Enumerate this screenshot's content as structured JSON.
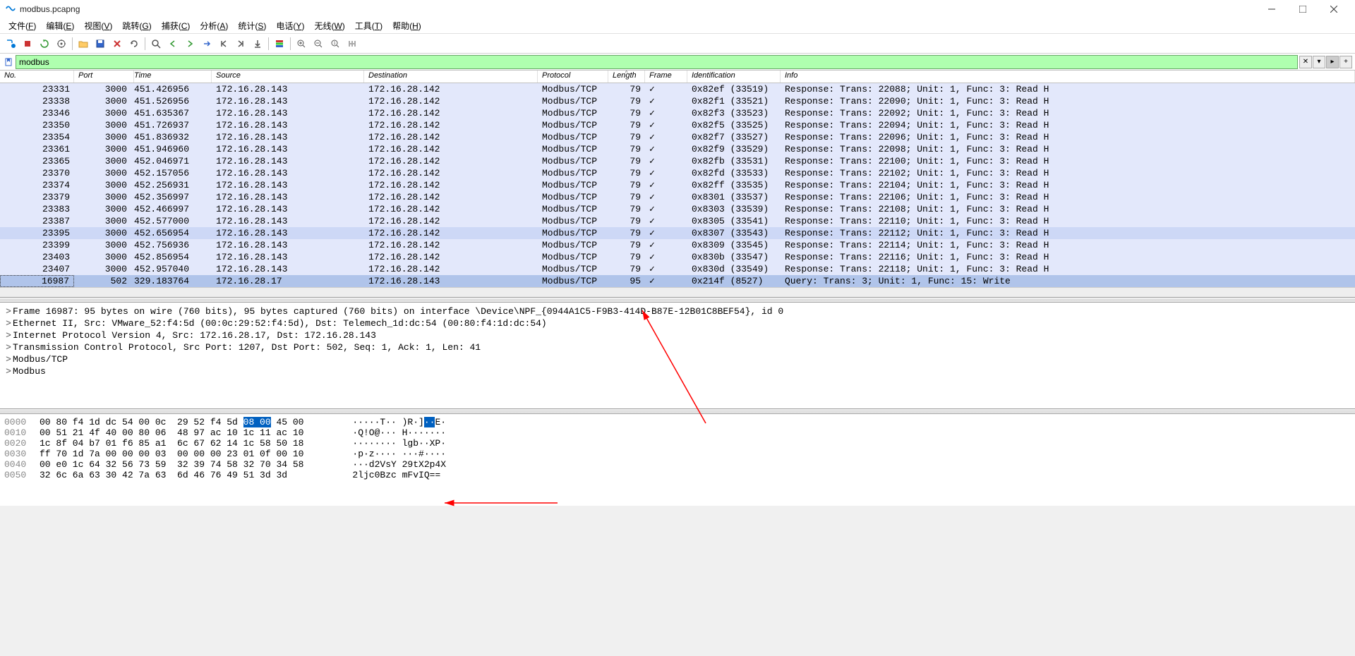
{
  "titlebar": {
    "title": "modbus.pcapng"
  },
  "menu": {
    "items": [
      {
        "l": "文件",
        "u": "F"
      },
      {
        "l": "编辑",
        "u": "E"
      },
      {
        "l": "视图",
        "u": "V"
      },
      {
        "l": "跳转",
        "u": "G"
      },
      {
        "l": "捕获",
        "u": "C"
      },
      {
        "l": "分析",
        "u": "A"
      },
      {
        "l": "统计",
        "u": "S"
      },
      {
        "l": "电话",
        "u": "Y"
      },
      {
        "l": "无线",
        "u": "W"
      },
      {
        "l": "工具",
        "u": "T"
      },
      {
        "l": "帮助",
        "u": "H"
      }
    ]
  },
  "filter": {
    "value": "modbus"
  },
  "columns": [
    "No.",
    "Port",
    "Time",
    "Source",
    "Destination",
    "Protocol",
    "Length",
    "Frame",
    "Identification",
    "Info"
  ],
  "rows": [
    {
      "no": "23331",
      "port": "3000",
      "time": "451.426956",
      "src": "172.16.28.143",
      "dst": "172.16.28.142",
      "proto": "Modbus/TCP",
      "len": "79",
      "frame": "✓",
      "ident": "0x82ef (33519)",
      "info": "Response: Trans: 22088; Unit:   1, Func:   3: Read H",
      "cls": "normal"
    },
    {
      "no": "23338",
      "port": "3000",
      "time": "451.526956",
      "src": "172.16.28.143",
      "dst": "172.16.28.142",
      "proto": "Modbus/TCP",
      "len": "79",
      "frame": "✓",
      "ident": "0x82f1 (33521)",
      "info": "Response: Trans: 22090; Unit:   1, Func:   3: Read H",
      "cls": "normal"
    },
    {
      "no": "23346",
      "port": "3000",
      "time": "451.635367",
      "src": "172.16.28.143",
      "dst": "172.16.28.142",
      "proto": "Modbus/TCP",
      "len": "79",
      "frame": "✓",
      "ident": "0x82f3 (33523)",
      "info": "Response: Trans: 22092; Unit:   1, Func:   3: Read H",
      "cls": "normal"
    },
    {
      "no": "23350",
      "port": "3000",
      "time": "451.726937",
      "src": "172.16.28.143",
      "dst": "172.16.28.142",
      "proto": "Modbus/TCP",
      "len": "79",
      "frame": "✓",
      "ident": "0x82f5 (33525)",
      "info": "Response: Trans: 22094; Unit:   1, Func:   3: Read H",
      "cls": "normal"
    },
    {
      "no": "23354",
      "port": "3000",
      "time": "451.836932",
      "src": "172.16.28.143",
      "dst": "172.16.28.142",
      "proto": "Modbus/TCP",
      "len": "79",
      "frame": "✓",
      "ident": "0x82f7 (33527)",
      "info": "Response: Trans: 22096; Unit:   1, Func:   3: Read H",
      "cls": "normal"
    },
    {
      "no": "23361",
      "port": "3000",
      "time": "451.946960",
      "src": "172.16.28.143",
      "dst": "172.16.28.142",
      "proto": "Modbus/TCP",
      "len": "79",
      "frame": "✓",
      "ident": "0x82f9 (33529)",
      "info": "Response: Trans: 22098; Unit:   1, Func:   3: Read H",
      "cls": "normal"
    },
    {
      "no": "23365",
      "port": "3000",
      "time": "452.046971",
      "src": "172.16.28.143",
      "dst": "172.16.28.142",
      "proto": "Modbus/TCP",
      "len": "79",
      "frame": "✓",
      "ident": "0x82fb (33531)",
      "info": "Response: Trans: 22100; Unit:   1, Func:   3: Read H",
      "cls": "normal"
    },
    {
      "no": "23370",
      "port": "3000",
      "time": "452.157056",
      "src": "172.16.28.143",
      "dst": "172.16.28.142",
      "proto": "Modbus/TCP",
      "len": "79",
      "frame": "✓",
      "ident": "0x82fd (33533)",
      "info": "Response: Trans: 22102; Unit:   1, Func:   3: Read H",
      "cls": "normal"
    },
    {
      "no": "23374",
      "port": "3000",
      "time": "452.256931",
      "src": "172.16.28.143",
      "dst": "172.16.28.142",
      "proto": "Modbus/TCP",
      "len": "79",
      "frame": "✓",
      "ident": "0x82ff (33535)",
      "info": "Response: Trans: 22104; Unit:   1, Func:   3: Read H",
      "cls": "normal"
    },
    {
      "no": "23379",
      "port": "3000",
      "time": "452.356997",
      "src": "172.16.28.143",
      "dst": "172.16.28.142",
      "proto": "Modbus/TCP",
      "len": "79",
      "frame": "✓",
      "ident": "0x8301 (33537)",
      "info": "Response: Trans: 22106; Unit:   1, Func:   3: Read H",
      "cls": "normal"
    },
    {
      "no": "23383",
      "port": "3000",
      "time": "452.466997",
      "src": "172.16.28.143",
      "dst": "172.16.28.142",
      "proto": "Modbus/TCP",
      "len": "79",
      "frame": "✓",
      "ident": "0x8303 (33539)",
      "info": "Response: Trans: 22108; Unit:   1, Func:   3: Read H",
      "cls": "normal"
    },
    {
      "no": "23387",
      "port": "3000",
      "time": "452.577000",
      "src": "172.16.28.143",
      "dst": "172.16.28.142",
      "proto": "Modbus/TCP",
      "len": "79",
      "frame": "✓",
      "ident": "0x8305 (33541)",
      "info": "Response: Trans: 22110; Unit:   1, Func:   3: Read H",
      "cls": "normal"
    },
    {
      "no": "23395",
      "port": "3000",
      "time": "452.656954",
      "src": "172.16.28.143",
      "dst": "172.16.28.142",
      "proto": "Modbus/TCP",
      "len": "79",
      "frame": "✓",
      "ident": "0x8307 (33543)",
      "info": "Response: Trans: 22112; Unit:   1, Func:   3: Read H",
      "cls": "sel1"
    },
    {
      "no": "23399",
      "port": "3000",
      "time": "452.756936",
      "src": "172.16.28.143",
      "dst": "172.16.28.142",
      "proto": "Modbus/TCP",
      "len": "79",
      "frame": "✓",
      "ident": "0x8309 (33545)",
      "info": "Response: Trans: 22114; Unit:   1, Func:   3: Read H",
      "cls": "normal"
    },
    {
      "no": "23403",
      "port": "3000",
      "time": "452.856954",
      "src": "172.16.28.143",
      "dst": "172.16.28.142",
      "proto": "Modbus/TCP",
      "len": "79",
      "frame": "✓",
      "ident": "0x830b (33547)",
      "info": "Response: Trans: 22116; Unit:   1, Func:   3: Read H",
      "cls": "normal"
    },
    {
      "no": "23407",
      "port": "3000",
      "time": "452.957040",
      "src": "172.16.28.143",
      "dst": "172.16.28.142",
      "proto": "Modbus/TCP",
      "len": "79",
      "frame": "✓",
      "ident": "0x830d (33549)",
      "info": "Response: Trans: 22118; Unit:   1, Func:   3: Read H",
      "cls": "normal"
    },
    {
      "no": "16987",
      "port": "502",
      "time": "329.183764",
      "src": "172.16.28.17",
      "dst": "172.16.28.143",
      "proto": "Modbus/TCP",
      "len": "95",
      "frame": "✓",
      "ident": "0x214f (8527)",
      "info": "   Query: Trans:     3; Unit:   1, Func:  15: Write ",
      "cls": "sel2"
    }
  ],
  "details": [
    {
      "tw": ">",
      "text": "Frame 16987: 95 bytes on wire (760 bits), 95 bytes captured (760 bits) on interface \\Device\\NPF_{0944A1C5-F9B3-414D-B87E-12B01C8BEF54}, id 0"
    },
    {
      "tw": ">",
      "text": "Ethernet II, Src: VMware_52:f4:5d (00:0c:29:52:f4:5d), Dst: Telemech_1d:dc:54 (00:80:f4:1d:dc:54)"
    },
    {
      "tw": ">",
      "text": "Internet Protocol Version 4, Src: 172.16.28.17, Dst: 172.16.28.143"
    },
    {
      "tw": ">",
      "text": "Transmission Control Protocol, Src Port: 1207, Dst Port: 502, Seq: 1, Ack: 1, Len: 41"
    },
    {
      "tw": ">",
      "text": "Modbus/TCP"
    },
    {
      "tw": ">",
      "text": "Modbus"
    }
  ],
  "hex": [
    {
      "off": "0000",
      "b1": "00 80 f4 1d dc 54 00 0c  29 52 f4 5d ",
      "hl": "08 00",
      "b2": " 45 00",
      "asc": "·····T·· )R·]",
      "ahl": "··",
      "asc2": "E·"
    },
    {
      "off": "0010",
      "b": "00 51 21 4f 40 00 80 06  48 97 ac 10 1c 11 ac 10",
      "asc": "·Q!O@··· H·······"
    },
    {
      "off": "0020",
      "b": "1c 8f 04 b7 01 f6 85 a1  6c 67 62 14 1c 58 50 18",
      "asc": "········ lgb··XP·"
    },
    {
      "off": "0030",
      "b": "ff 70 1d 7a 00 00 00 03  00 00 00 23 01 0f 00 10",
      "asc": "·p·z···· ···#····"
    },
    {
      "off": "0040",
      "b": "00 e0 1c 64 32 56 73 59  32 39 74 58 32 70 34 58",
      "asc": "···d2VsY 29tX2p4X"
    },
    {
      "off": "0050",
      "b": "32 6c 6a 63 30 42 7a 63  6d 46 76 49 51 3d 3d",
      "asc": "2ljc0Bzc mFvIQ=="
    }
  ]
}
